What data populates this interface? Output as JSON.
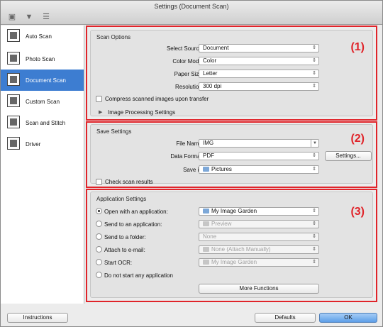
{
  "window": {
    "title": "Settings (Document Scan)"
  },
  "sidebar": {
    "items": [
      {
        "label": "Auto Scan",
        "icon": "auto-scan-icon",
        "active": false
      },
      {
        "label": "Photo Scan",
        "icon": "photo-scan-icon",
        "active": false
      },
      {
        "label": "Document Scan",
        "icon": "document-scan-icon",
        "active": true
      },
      {
        "label": "Custom Scan",
        "icon": "custom-scan-icon",
        "active": false
      },
      {
        "label": "Scan and Stitch",
        "icon": "scan-and-stitch-icon",
        "active": false
      },
      {
        "label": "Driver",
        "icon": "driver-icon",
        "active": false
      }
    ]
  },
  "scan_options": {
    "title": "Scan Options",
    "marker": "(1)",
    "select_source": {
      "label": "Select Source:",
      "value": "Document"
    },
    "color_mode": {
      "label": "Color Mode:",
      "value": "Color"
    },
    "paper_size": {
      "label": "Paper Size:",
      "value": "Letter"
    },
    "resolution": {
      "label": "Resolution:",
      "value": "300 dpi"
    },
    "compress_label": "Compress scanned images upon transfer",
    "image_processing_label": "Image Processing Settings"
  },
  "save_settings": {
    "title": "Save Settings",
    "marker": "(2)",
    "file_name": {
      "label": "File Name:",
      "value": "IMG"
    },
    "data_format": {
      "label": "Data Format:",
      "value": "PDF"
    },
    "settings_button": "Settings...",
    "save_in": {
      "label": "Save in:",
      "value": "Pictures"
    },
    "check_results_label": "Check scan results"
  },
  "application_settings": {
    "title": "Application Settings",
    "marker": "(3)",
    "options": [
      {
        "label": "Open with an application:",
        "value": "My Image Garden",
        "selected": true,
        "enabled": true
      },
      {
        "label": "Send to an application:",
        "value": "Preview",
        "selected": false,
        "enabled": false
      },
      {
        "label": "Send to a folder:",
        "value": "None",
        "selected": false,
        "enabled": false
      },
      {
        "label": "Attach to e-mail:",
        "value": "None (Attach Manually)",
        "selected": false,
        "enabled": false
      },
      {
        "label": "Start OCR:",
        "value": "My Image Garden",
        "selected": false,
        "enabled": false
      },
      {
        "label": "Do not start any application",
        "value": "",
        "selected": false,
        "enabled": true
      }
    ],
    "more_functions_button": "More Functions"
  },
  "footer": {
    "instructions_button": "Instructions",
    "defaults_button": "Defaults",
    "ok_button": "OK"
  },
  "colors": {
    "accent": "#3d7dd1",
    "marker": "#e0242a"
  }
}
